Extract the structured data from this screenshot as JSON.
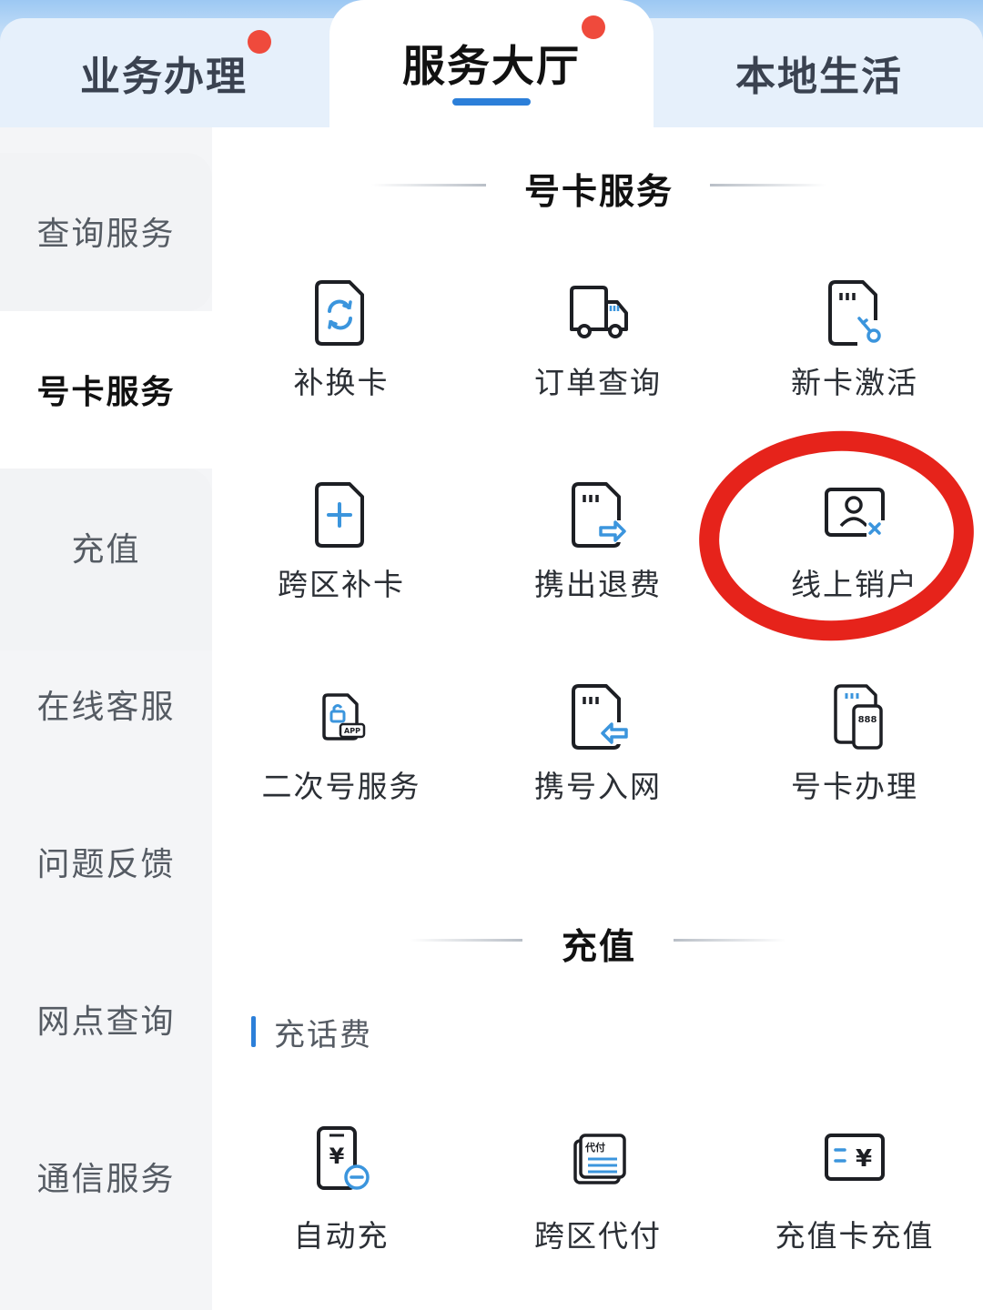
{
  "tabs": [
    {
      "label": "业务办理",
      "has_badge": true
    },
    {
      "label": "服务大厅",
      "has_badge": true,
      "active": true
    },
    {
      "label": "本地生活",
      "has_badge": false
    }
  ],
  "sidebar": {
    "items": [
      {
        "label": "查询服务"
      },
      {
        "label": "号卡服务",
        "active": true
      },
      {
        "label": "充值"
      },
      {
        "label": "在线客服"
      },
      {
        "label": "问题反馈"
      },
      {
        "label": "网点查询"
      },
      {
        "label": "通信服务"
      }
    ]
  },
  "sections": {
    "card_service": {
      "title": "号卡服务",
      "items": [
        {
          "label": "补换卡",
          "icon": "sim-swap-icon"
        },
        {
          "label": "订单查询",
          "icon": "delivery-truck-icon"
        },
        {
          "label": "新卡激活",
          "icon": "sim-key-icon"
        },
        {
          "label": "跨区补卡",
          "icon": "sim-plus-icon"
        },
        {
          "label": "携出退费",
          "icon": "sim-transfer-out-icon"
        },
        {
          "label": "线上销户",
          "icon": "id-card-remove-icon"
        },
        {
          "label": "二次号服务",
          "icon": "app-lock-icon"
        },
        {
          "label": "携号入网",
          "icon": "sim-transfer-in-icon"
        },
        {
          "label": "号卡办理",
          "icon": "sim-number-icon"
        }
      ]
    },
    "recharge": {
      "title": "充值",
      "subheading": "充话费",
      "items": [
        {
          "label": "自动充",
          "icon": "phone-yuan-auto-icon"
        },
        {
          "label": "跨区代付",
          "icon": "proxy-pay-icon"
        },
        {
          "label": "充值卡充值",
          "icon": "recharge-card-icon"
        }
      ]
    }
  },
  "colors": {
    "accent": "#2c7fd9",
    "badge": "#ef4a3c",
    "highlight_ring": "#e6231b",
    "icon_blue": "#3b95dd"
  }
}
